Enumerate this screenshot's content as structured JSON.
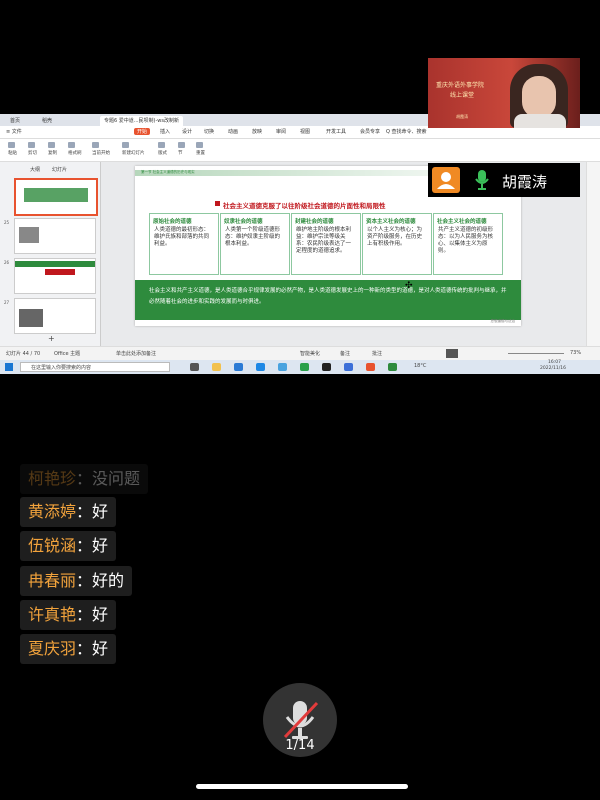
{
  "desktop": {
    "tabs": [
      {
        "label": "首页"
      },
      {
        "label": "稻壳"
      },
      {
        "label": "专题6 爱中道...民坝制)-ws改制新"
      }
    ],
    "menu": {
      "file": "≡ 文件",
      "items": [
        "开始",
        "插入",
        "设计",
        "切换",
        "动画",
        "放映",
        "审阅",
        "视图",
        "开发工具",
        "会员专享"
      ],
      "search": "Q 查找命令、搜索"
    },
    "ribbon": [
      "粘贴",
      "剪切",
      "复制",
      "格式刷",
      "当前开始",
      "新建幻灯片",
      "版式",
      "节",
      "重置"
    ],
    "panel": {
      "tab_outline": "大纲",
      "tab_slides": "幻灯片",
      "slide_numbers": [
        "25",
        "26",
        "27"
      ],
      "add": "+"
    },
    "slide": {
      "header_small": "第一节 社会主义道德的历史与现实",
      "title": "社会主义道德克服了以往阶级社会道德的片面性和局限性",
      "cards": [
        {
          "head": "原始社会的道德",
          "body": "人类道德的最初形态：维护氏族和部落的共同利益。"
        },
        {
          "head": "奴隶社会的道德",
          "body": "人类第一个阶级道德形态：维护奴隶主阶级的根本利益。"
        },
        {
          "head": "封建社会的道德",
          "body": "维护地主阶级的根本利益：维护宗法等级关系：农民阶级表达了一定程度的道德追求。"
        },
        {
          "head": "资本主义社会的道德",
          "body": "以个人主义为核心；为资产阶级服务，在历史上有积极作用。"
        },
        {
          "head": "社会主义社会的道德",
          "body": "共产主义道德的初级形态：以为人民服务为核心、以集体主义为原则。"
        }
      ],
      "body": "社会主义和共产主义道德，是人类道德合乎规律发展的必然产物，是人类道德发展史上的一种新的类型的道德，是对人类道德传统的批判与继承，并必然随着社会的进步和实践的发展而与时俱进。",
      "footer": "思想道德与法治"
    },
    "status": {
      "slide_count": "幻灯片 44 / 70",
      "theme": "Office 主题",
      "notes_placeholder": "单击此处添加备注",
      "smart_beautify": "智能美化",
      "notes": "备注",
      "comments": "批注",
      "zoom": "73%"
    },
    "taskbar": {
      "search_placeholder": "在这里输入你要搜索的内容",
      "temp": "18°C",
      "time": "16:07",
      "date": "2022/11/16"
    }
  },
  "video": {
    "banner_line1": "重庆外语外事学院",
    "banner_line2": "线上课堂",
    "presenter_tag": "胡霞涛",
    "speaker_name": "胡霞涛"
  },
  "chat": [
    {
      "name": "柯艳珍",
      "sep": "：",
      "msg": "没问题"
    },
    {
      "name": "黄添婷",
      "sep": "：",
      "msg": "好"
    },
    {
      "name": "伍锐涵",
      "sep": "：",
      "msg": "好"
    },
    {
      "name": "冉春丽",
      "sep": "：",
      "msg": "好的"
    },
    {
      "name": "许真艳",
      "sep": "：",
      "msg": "好"
    },
    {
      "name": "夏庆羽",
      "sep": "：",
      "msg": "好"
    }
  ],
  "controls": {
    "mic_state": "muted",
    "page_indicator": "1/14"
  },
  "colors": {
    "accent": "#e8532f",
    "slide_green": "#2e8b3d",
    "slide_red": "#c0171d",
    "chat_name": "#f2a33c",
    "mute_red": "#e23b3b"
  }
}
